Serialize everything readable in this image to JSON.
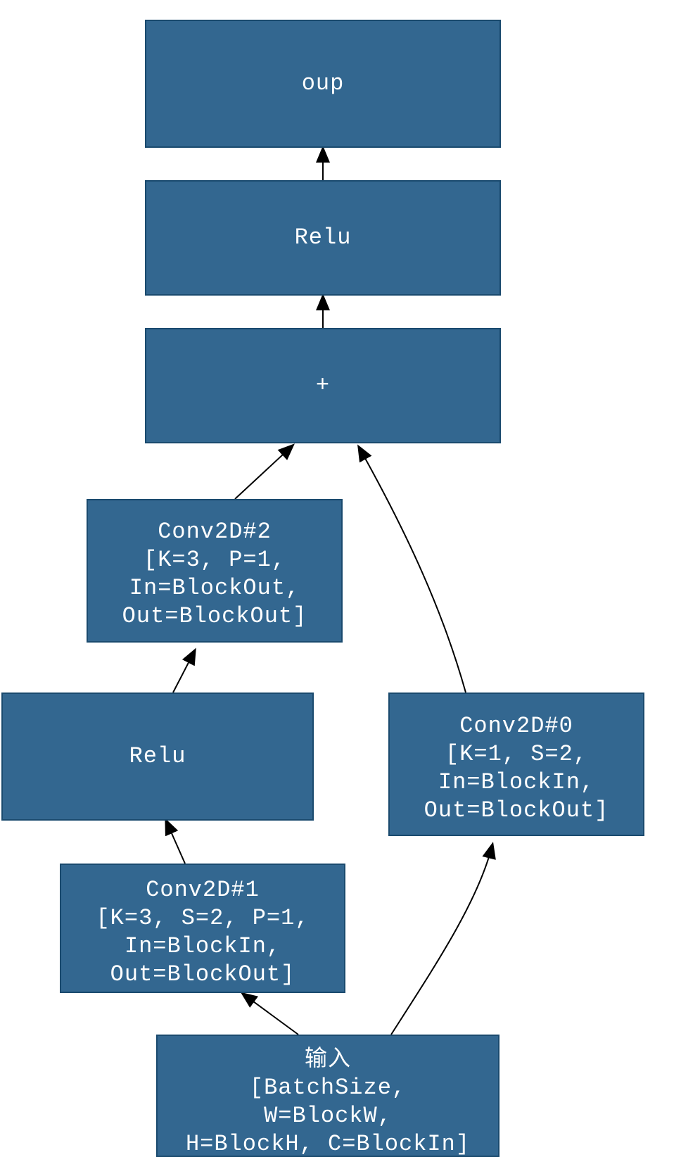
{
  "diagram_type": "neural-network-block",
  "color": "#336790",
  "nodes": {
    "oup": {
      "label": "oup"
    },
    "relu2": {
      "label": "Relu"
    },
    "add": {
      "label": "+"
    },
    "conv2": {
      "line1": "Conv2D#2",
      "line2": "[K=3,  P=1,",
      "line3": "In=BlockOut,",
      "line4": "Out=BlockOut]"
    },
    "relu1": {
      "label": "Relu"
    },
    "conv0": {
      "line1": "Conv2D#0",
      "line2": "[K=1,  S=2,",
      "line3": "In=BlockIn,",
      "line4": "Out=BlockOut]"
    },
    "conv1": {
      "line1": "Conv2D#1",
      "line2": "[K=3, S=2, P=1,",
      "line3": "In=BlockIn,",
      "line4": "Out=BlockOut]"
    },
    "input": {
      "line1": "输入",
      "line2": "[BatchSize,",
      "line3": "W=BlockW,",
      "line4": "H=BlockH, C=BlockIn]"
    }
  }
}
